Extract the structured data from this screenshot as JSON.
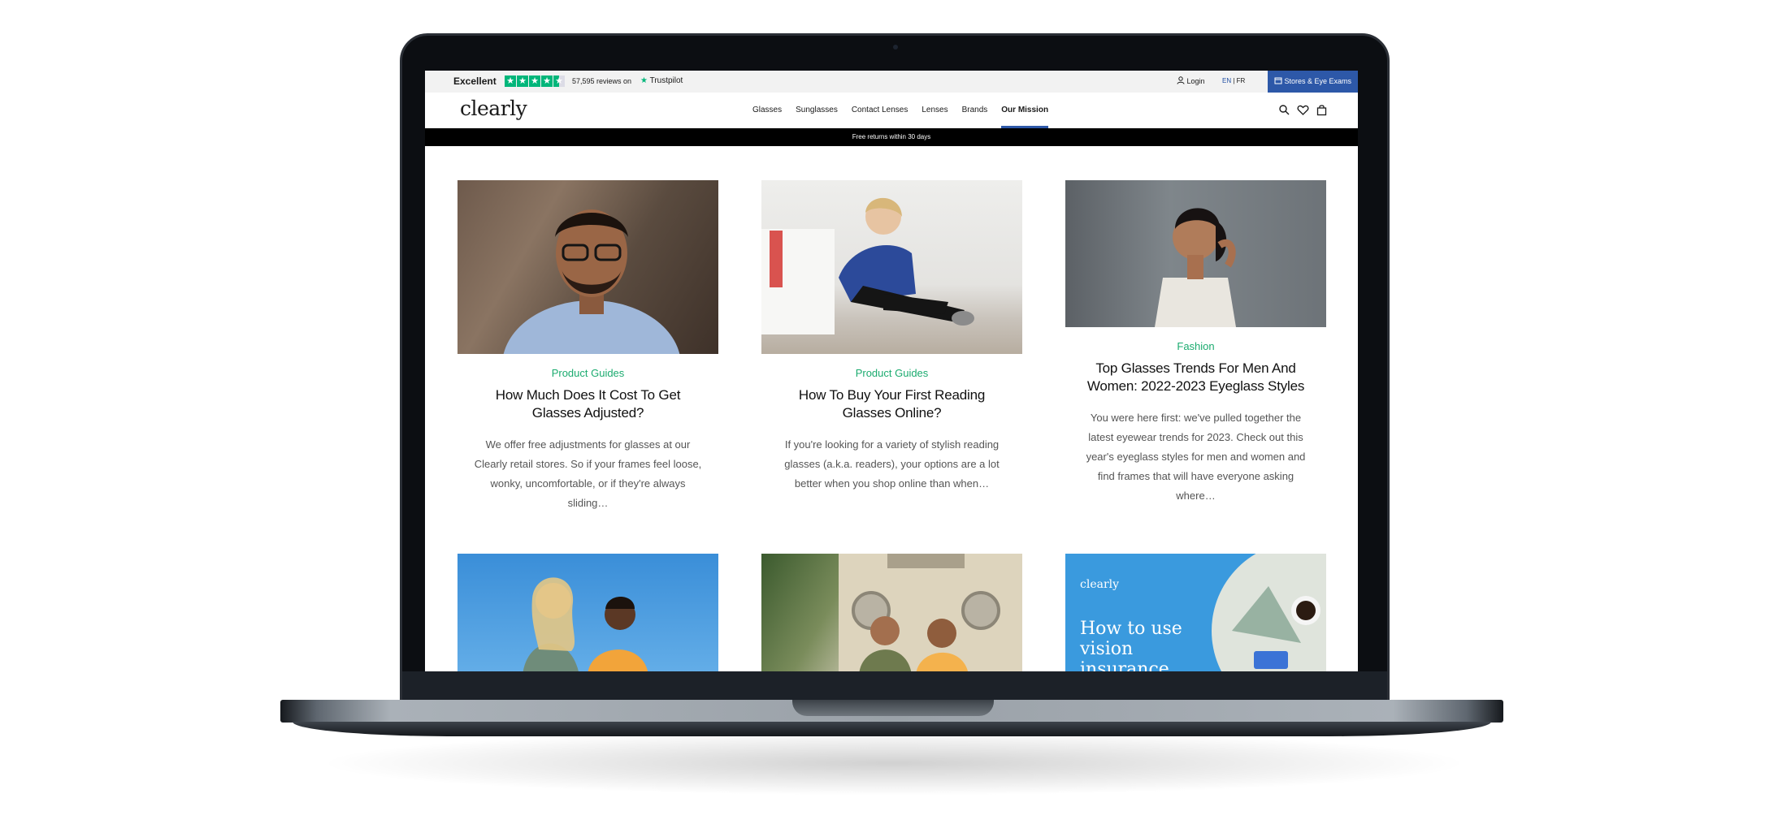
{
  "topbar": {
    "rating_label": "Excellent",
    "reviews_text": "57,595 reviews on",
    "trustpilot_label": "Trustpilot",
    "login_label": "Login",
    "lang_en": "EN",
    "lang_sep": "|",
    "lang_fr": "FR",
    "stores_button": "Stores & Eye Exams"
  },
  "header": {
    "logo_text": "clearly",
    "nav": [
      "Glasses",
      "Sunglasses",
      "Contact Lenses",
      "Lenses",
      "Brands",
      "Our Mission"
    ],
    "active_nav": "Our Mission"
  },
  "promo_text": "Free returns within 30 days",
  "articles": [
    {
      "category": "Product Guides",
      "title": "How Much Does It Cost To Get Glasses Adjusted?",
      "excerpt": "We offer free adjustments for glasses at our Clearly retail stores. So if your frames feel loose, wonky, uncomfortable, or if they're always sliding…"
    },
    {
      "category": "Product Guides",
      "title": "How To Buy Your First Reading Glasses Online?",
      "excerpt": "If you're looking for a variety of stylish reading glasses (a.k.a. readers), your options are a lot better when you shop online than when…"
    },
    {
      "category": "Fashion",
      "title": "Top Glasses Trends For Men And Women: 2022-2023 Eyeglass Styles",
      "excerpt": "You were here first: we've pulled together the latest eyewear trends for 2023. Check out this year's eyeglass styles for men and women and find frames that will have everyone asking where…"
    }
  ],
  "promo_card": {
    "logo": "clearly",
    "headline": "How to use vision insurance"
  },
  "colors": {
    "category_green": "#1bab6f",
    "brand_blue": "#2d58a8",
    "trustpilot_green": "#00b67a"
  }
}
